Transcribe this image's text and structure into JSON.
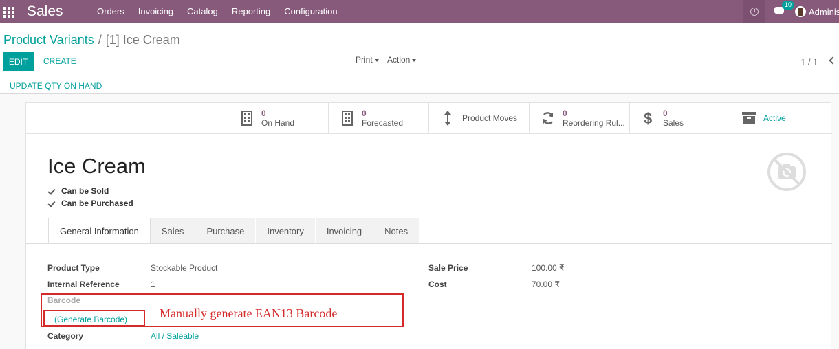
{
  "navbar": {
    "app_name": "Sales",
    "menu": [
      "Orders",
      "Invoicing",
      "Catalog",
      "Reporting",
      "Configuration"
    ],
    "notification_count": "10",
    "user": "Adminis"
  },
  "control_panel": {
    "breadcrumb_parent": "Product Variants",
    "breadcrumb_separator": "/",
    "breadcrumb_current": "[1] Ice Cream",
    "edit_label": "EDIT",
    "create_label": "CREATE",
    "print_label": "Print",
    "action_label": "Action",
    "pager": "1 / 1",
    "update_qty_label": "UPDATE QTY ON HAND"
  },
  "stat_buttons": {
    "on_hand": {
      "value": "0",
      "label": "On Hand"
    },
    "forecasted": {
      "value": "0",
      "label": "Forecasted"
    },
    "product_moves": {
      "label": "Product Moves"
    },
    "reordering": {
      "value": "0",
      "label": "Reordering Rul..."
    },
    "sales": {
      "value": "0",
      "label": "Sales"
    },
    "active": {
      "label": "Active"
    }
  },
  "product": {
    "name": "Ice Cream",
    "can_be_sold": "Can be Sold",
    "can_be_purchased": "Can be Purchased"
  },
  "tabs": [
    "General Information",
    "Sales",
    "Purchase",
    "Inventory",
    "Invoicing",
    "Notes"
  ],
  "fields": {
    "product_type_label": "Product Type",
    "product_type_value": "Stockable Product",
    "internal_ref_label": "Internal Reference",
    "internal_ref_value": "1",
    "barcode_label": "Barcode",
    "generate_barcode": "(Generate Barcode)",
    "category_label": "Category",
    "category_value": "All / Saleable",
    "sale_price_label": "Sale Price",
    "sale_price_value": "100.00 ₹",
    "cost_label": "Cost",
    "cost_value": "70.00 ₹"
  },
  "annotation": {
    "text": "Manually generate EAN13 Barcode"
  },
  "colors": {
    "navbar": "#875a7b",
    "accent": "#00a09d",
    "annotation": "#d52a2a"
  }
}
